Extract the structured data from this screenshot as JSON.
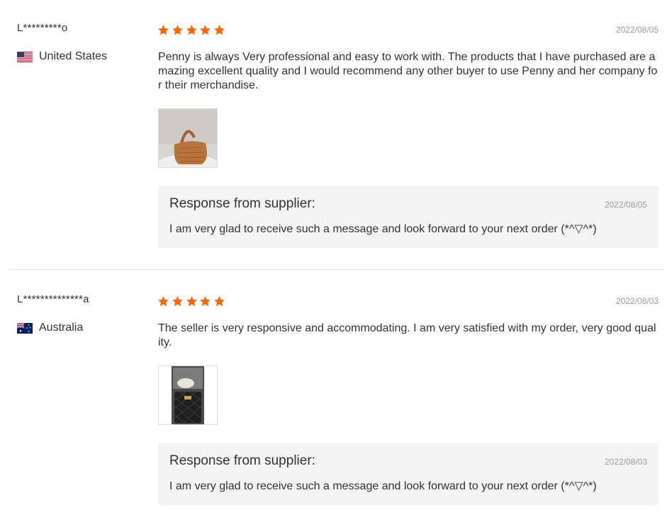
{
  "reviews": [
    {
      "user": "L*********o",
      "country": "United States",
      "flag_icon": "us-flag-icon",
      "rating": 5,
      "date": "2022/08/05",
      "text": "Penny is always Very professional and easy to work with. The products that I have purchased are amazing excellent quality and I would recommend any other buyer to use Penny and her company for their merchandise.",
      "photo_icon": "handbag-photo",
      "response": {
        "title": "Response from supplier:",
        "date": "2022/08/05",
        "text": "I am very glad to receive such a message and look forward to your next order (*^▽^*)"
      }
    },
    {
      "user": "L**************a",
      "country": "Australia",
      "flag_icon": "au-flag-icon",
      "rating": 5,
      "date": "2022/08/03",
      "text": "The seller is very responsive and accommodating. I am very satisfied with my order, very good quality.",
      "photo_icon": "quilted-bag-photo",
      "response": {
        "title": "Response from supplier:",
        "date": "2022/08/03",
        "text": "I am very glad to receive such a message and look forward to your next order (*^▽^*)"
      }
    }
  ],
  "colors": {
    "star": "#ff6600",
    "muted": "#999999",
    "response_bg": "#f4f4f4"
  }
}
